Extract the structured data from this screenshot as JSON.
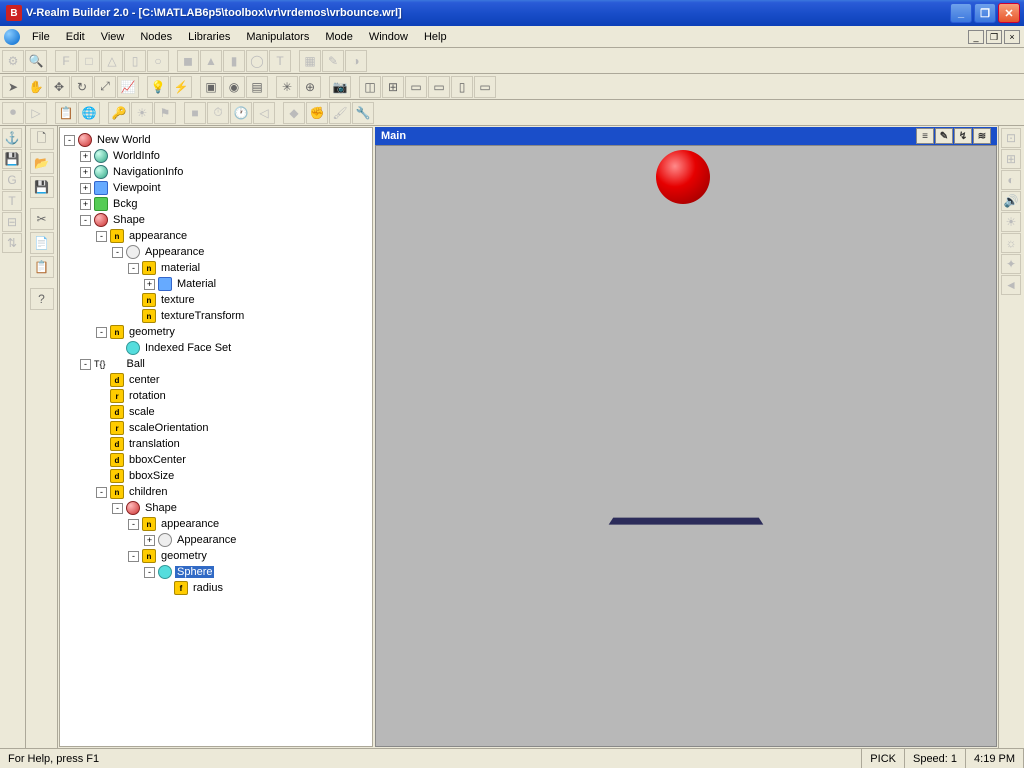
{
  "title": "V-Realm Builder 2.0 - [C:\\MATLAB6p5\\toolbox\\vr\\vrdemos\\vrbounce.wrl]",
  "menu": [
    "File",
    "Edit",
    "View",
    "Nodes",
    "Libraries",
    "Manipulators",
    "Mode",
    "Window",
    "Help"
  ],
  "viewport_title": "Main",
  "status": {
    "help": "For Help, press F1",
    "mode": "PICK",
    "speed": "Speed: 1",
    "time": "4:19 PM"
  },
  "tree": [
    {
      "d": 0,
      "exp": "-",
      "icon": "ic-red",
      "label": "New World"
    },
    {
      "d": 1,
      "exp": "+",
      "icon": "ic-globe",
      "label": "WorldInfo"
    },
    {
      "d": 1,
      "exp": "+",
      "icon": "ic-globe",
      "label": "NavigationInfo"
    },
    {
      "d": 1,
      "exp": "+",
      "icon": "ic-b",
      "label": "Viewpoint"
    },
    {
      "d": 1,
      "exp": "+",
      "icon": "ic-g",
      "label": "Bckg"
    },
    {
      "d": 1,
      "exp": "-",
      "icon": "ic-red",
      "label": "Shape"
    },
    {
      "d": 2,
      "exp": "-",
      "icon": "ic-y",
      "t": "n",
      "label": "appearance"
    },
    {
      "d": 3,
      "exp": "-",
      "icon": "ic-mag",
      "label": "Appearance"
    },
    {
      "d": 4,
      "exp": "-",
      "icon": "ic-y",
      "t": "n",
      "label": "material"
    },
    {
      "d": 5,
      "exp": "+",
      "icon": "ic-b",
      "label": "Material"
    },
    {
      "d": 4,
      "exp": " ",
      "icon": "ic-y",
      "t": "n",
      "label": "texture"
    },
    {
      "d": 4,
      "exp": " ",
      "icon": "ic-y",
      "t": "n",
      "label": "textureTransform"
    },
    {
      "d": 2,
      "exp": "-",
      "icon": "ic-y",
      "t": "n",
      "label": "geometry"
    },
    {
      "d": 3,
      "exp": " ",
      "icon": "ic-c",
      "label": "Indexed Face Set"
    },
    {
      "d": 1,
      "exp": "-",
      "icon": "",
      "label": "Ball",
      "pre": "T{}"
    },
    {
      "d": 2,
      "exp": " ",
      "icon": "ic-y",
      "t": "d",
      "label": "center"
    },
    {
      "d": 2,
      "exp": " ",
      "icon": "ic-y",
      "t": "r",
      "label": "rotation"
    },
    {
      "d": 2,
      "exp": " ",
      "icon": "ic-y",
      "t": "d",
      "label": "scale"
    },
    {
      "d": 2,
      "exp": " ",
      "icon": "ic-y",
      "t": "r",
      "label": "scaleOrientation"
    },
    {
      "d": 2,
      "exp": " ",
      "icon": "ic-y",
      "t": "d",
      "label": "translation"
    },
    {
      "d": 2,
      "exp": " ",
      "icon": "ic-y",
      "t": "d",
      "label": "bboxCenter"
    },
    {
      "d": 2,
      "exp": " ",
      "icon": "ic-y",
      "t": "d",
      "label": "bboxSize"
    },
    {
      "d": 2,
      "exp": "-",
      "icon": "ic-y",
      "t": "n",
      "label": "children"
    },
    {
      "d": 3,
      "exp": "-",
      "icon": "ic-red",
      "label": "Shape"
    },
    {
      "d": 4,
      "exp": "-",
      "icon": "ic-y",
      "t": "n",
      "label": "appearance"
    },
    {
      "d": 5,
      "exp": "+",
      "icon": "ic-mag",
      "label": "Appearance"
    },
    {
      "d": 4,
      "exp": "-",
      "icon": "ic-y",
      "t": "n",
      "label": "geometry"
    },
    {
      "d": 5,
      "exp": "-",
      "icon": "ic-c",
      "label": "Sphere",
      "sel": true
    },
    {
      "d": 6,
      "exp": " ",
      "icon": "ic-y",
      "t": "f",
      "label": "radius"
    }
  ]
}
